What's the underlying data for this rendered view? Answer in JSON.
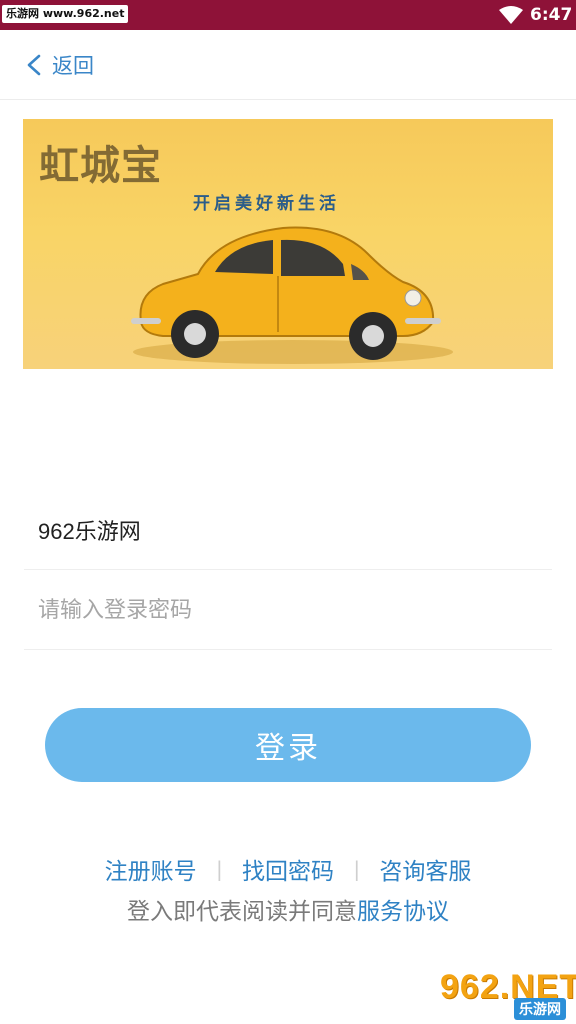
{
  "status_bar": {
    "site_badge": "乐游网 www.962.net",
    "time": "6:47",
    "wifi_icon": "wifi-icon",
    "background": "#8e1238"
  },
  "header": {
    "back_label": "返回",
    "back_icon": "chevron-left-icon"
  },
  "banner": {
    "brand": "虹城宝",
    "slogan": "开启美好新生活"
  },
  "form": {
    "username_value": "962乐游网",
    "password_placeholder": "请输入登录密码",
    "login_label": "登录"
  },
  "links": {
    "register": "注册账号",
    "forgot_password": "找回密码",
    "customer_service": "咨询客服",
    "agreement_prefix": "登入即代表阅读并同意",
    "agreement_link": "服务协议"
  },
  "watermark": {
    "main": "962.NET",
    "sub": "乐游网"
  },
  "colors": {
    "accent": "#2f82c4",
    "button": "#6bb9ec",
    "banner_bg": "#f9d466"
  }
}
